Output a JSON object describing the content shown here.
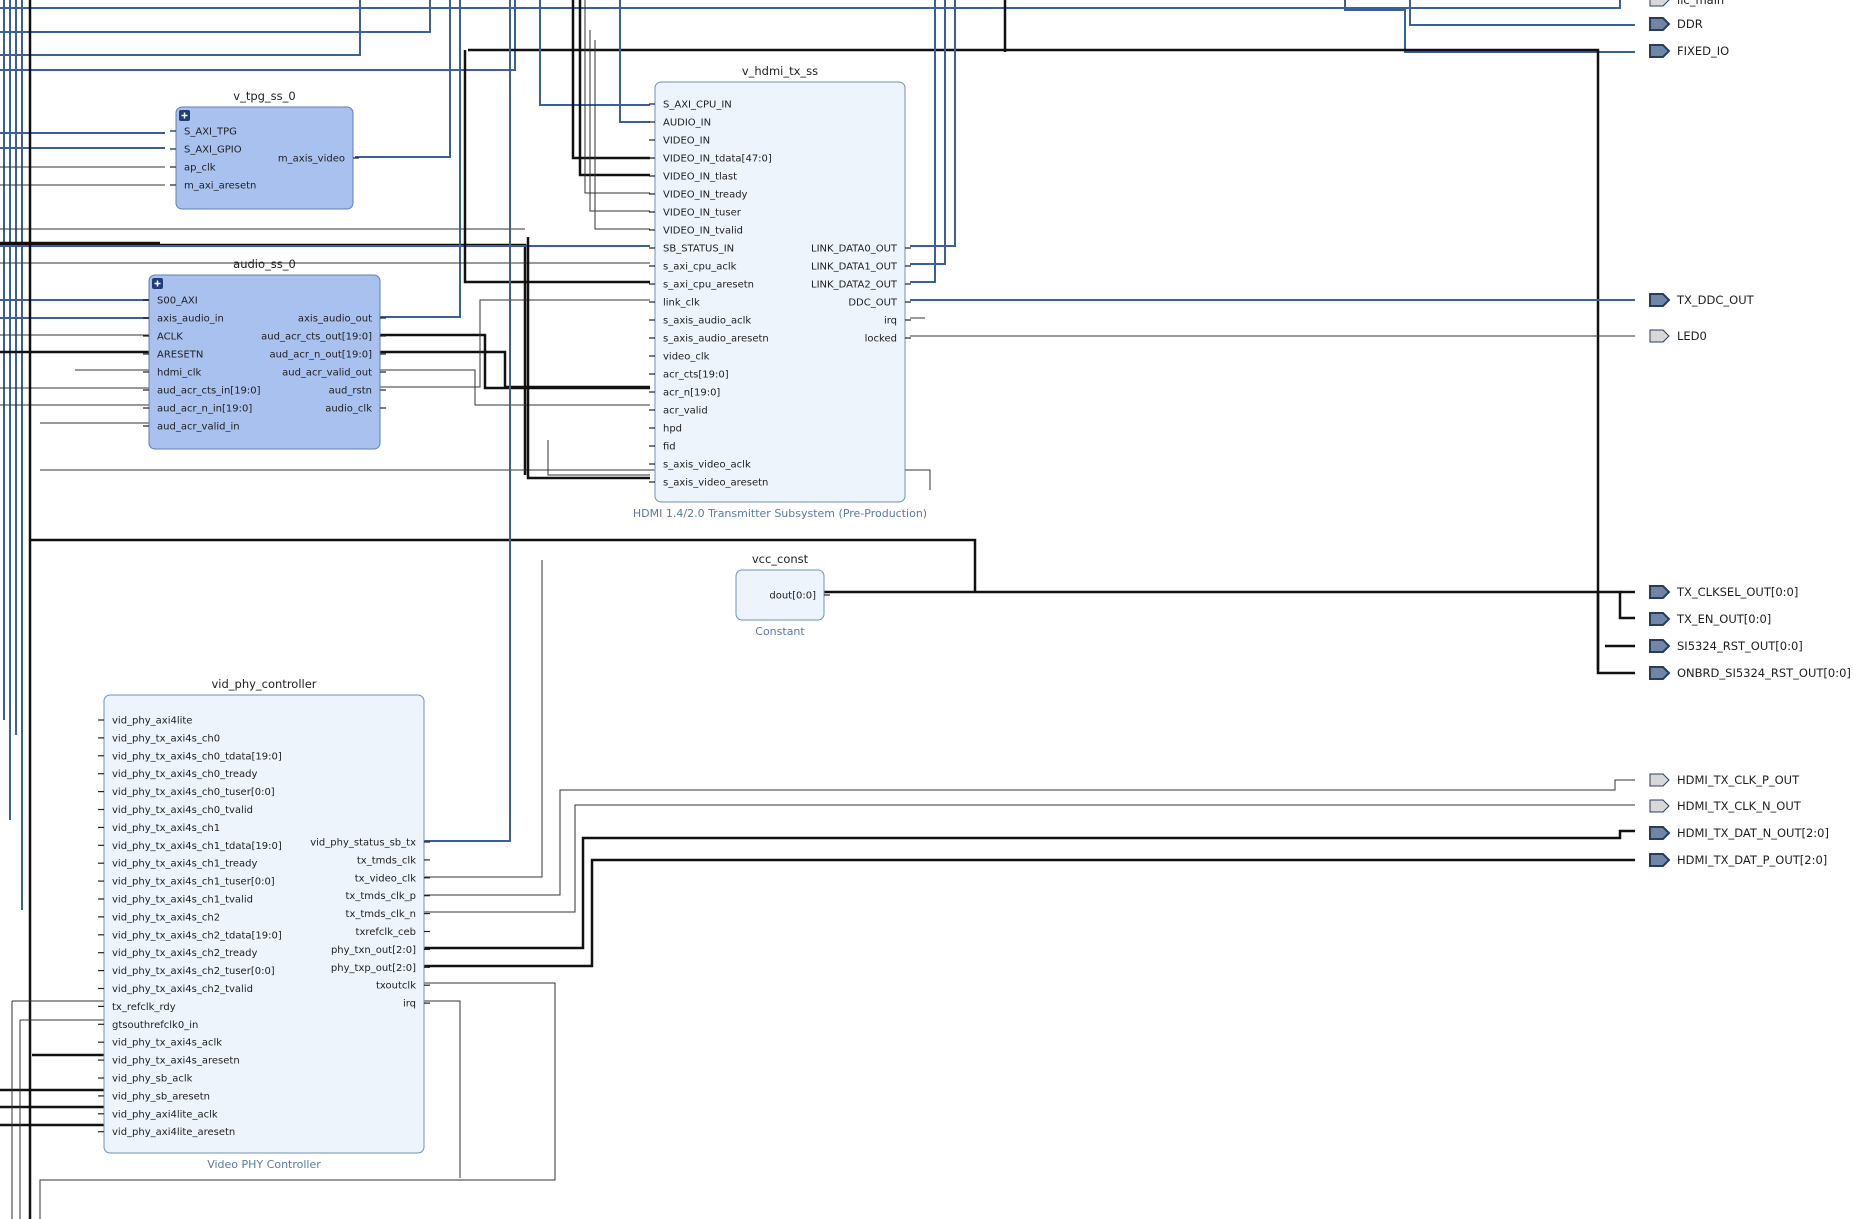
{
  "blocks": {
    "tpg": {
      "name": "v_tpg_ss_0",
      "pins_left": [
        "S_AXI_TPG",
        "S_AXI_GPIO",
        "ap_clk",
        "m_axi_aresetn"
      ],
      "pins_right": [
        "m_axis_video"
      ]
    },
    "audio": {
      "name": "audio_ss_0",
      "pins_left": [
        "S00_AXI",
        "axis_audio_in",
        "ACLK",
        "ARESETN",
        "hdmi_clk",
        "aud_acr_cts_in[19:0]",
        "aud_acr_n_in[19:0]",
        "aud_acr_valid_in"
      ],
      "pins_right": [
        "axis_audio_out",
        "aud_acr_cts_out[19:0]",
        "aud_acr_n_out[19:0]",
        "aud_acr_valid_out",
        "aud_rstn",
        "audio_clk"
      ]
    },
    "hdmi": {
      "name": "v_hdmi_tx_ss",
      "subtitle": "HDMI 1.4/2.0 Transmitter Subsystem (Pre-Production)",
      "pins_left": [
        "S_AXI_CPU_IN",
        "AUDIO_IN",
        "VIDEO_IN",
        "VIDEO_IN_tdata[47:0]",
        "VIDEO_IN_tlast",
        "VIDEO_IN_tready",
        "VIDEO_IN_tuser",
        "VIDEO_IN_tvalid",
        "SB_STATUS_IN",
        "s_axi_cpu_aclk",
        "s_axi_cpu_aresetn",
        "link_clk",
        "s_axis_audio_aclk",
        "s_axis_audio_aresetn",
        "video_clk",
        "acr_cts[19:0]",
        "acr_n[19:0]",
        "acr_valid",
        "hpd",
        "fid",
        "s_axis_video_aclk",
        "s_axis_video_aresetn"
      ],
      "pins_right": [
        "LINK_DATA0_OUT",
        "LINK_DATA1_OUT",
        "LINK_DATA2_OUT",
        "DDC_OUT",
        "irq",
        "locked"
      ]
    },
    "vcc": {
      "name": "vcc_const",
      "subtitle": "Constant",
      "pins_right": [
        "dout[0:0]"
      ]
    },
    "phy": {
      "name": "vid_phy_controller",
      "subtitle": "Video PHY Controller",
      "pins_left": [
        "vid_phy_axi4lite",
        "vid_phy_tx_axi4s_ch0",
        "vid_phy_tx_axi4s_ch0_tdata[19:0]",
        "vid_phy_tx_axi4s_ch0_tready",
        "vid_phy_tx_axi4s_ch0_tuser[0:0]",
        "vid_phy_tx_axi4s_ch0_tvalid",
        "vid_phy_tx_axi4s_ch1",
        "vid_phy_tx_axi4s_ch1_tdata[19:0]",
        "vid_phy_tx_axi4s_ch1_tready",
        "vid_phy_tx_axi4s_ch1_tuser[0:0]",
        "vid_phy_tx_axi4s_ch1_tvalid",
        "vid_phy_tx_axi4s_ch2",
        "vid_phy_tx_axi4s_ch2_tdata[19:0]",
        "vid_phy_tx_axi4s_ch2_tready",
        "vid_phy_tx_axi4s_ch2_tuser[0:0]",
        "vid_phy_tx_axi4s_ch2_tvalid",
        "tx_refclk_rdy",
        "gtsouthrefclk0_in",
        "vid_phy_tx_axi4s_aclk",
        "vid_phy_tx_axi4s_aresetn",
        "vid_phy_sb_aclk",
        "vid_phy_sb_aresetn",
        "vid_phy_axi4lite_aclk",
        "vid_phy_axi4lite_aresetn"
      ],
      "pins_right": [
        "vid_phy_status_sb_tx",
        "tx_tmds_clk",
        "tx_video_clk",
        "tx_tmds_clk_p",
        "tx_tmds_clk_n",
        "txrefclk_ceb",
        "phy_txn_out[2:0]",
        "phy_txp_out[2:0]",
        "txoutclk",
        "irq"
      ]
    }
  },
  "external_ports": [
    "lic_main",
    "DDR",
    "FIXED_IO",
    "TX_DDC_OUT",
    "LED0",
    "TX_CLKSEL_OUT[0:0]",
    "TX_EN_OUT[0:0]",
    "SI5324_RST_OUT[0:0]",
    "ONBRD_SI5324_RST_OUT[0:0]",
    "HDMI_TX_CLK_P_OUT",
    "HDMI_TX_CLK_N_OUT",
    "HDMI_TX_DAT_N_OUT[2:0]",
    "HDMI_TX_DAT_P_OUT[2:0]"
  ],
  "colors": {
    "block_light": "#eef4fc",
    "block_dark": "#a9c1ee",
    "bus": "#3a5f9a",
    "wire": "#111111"
  }
}
